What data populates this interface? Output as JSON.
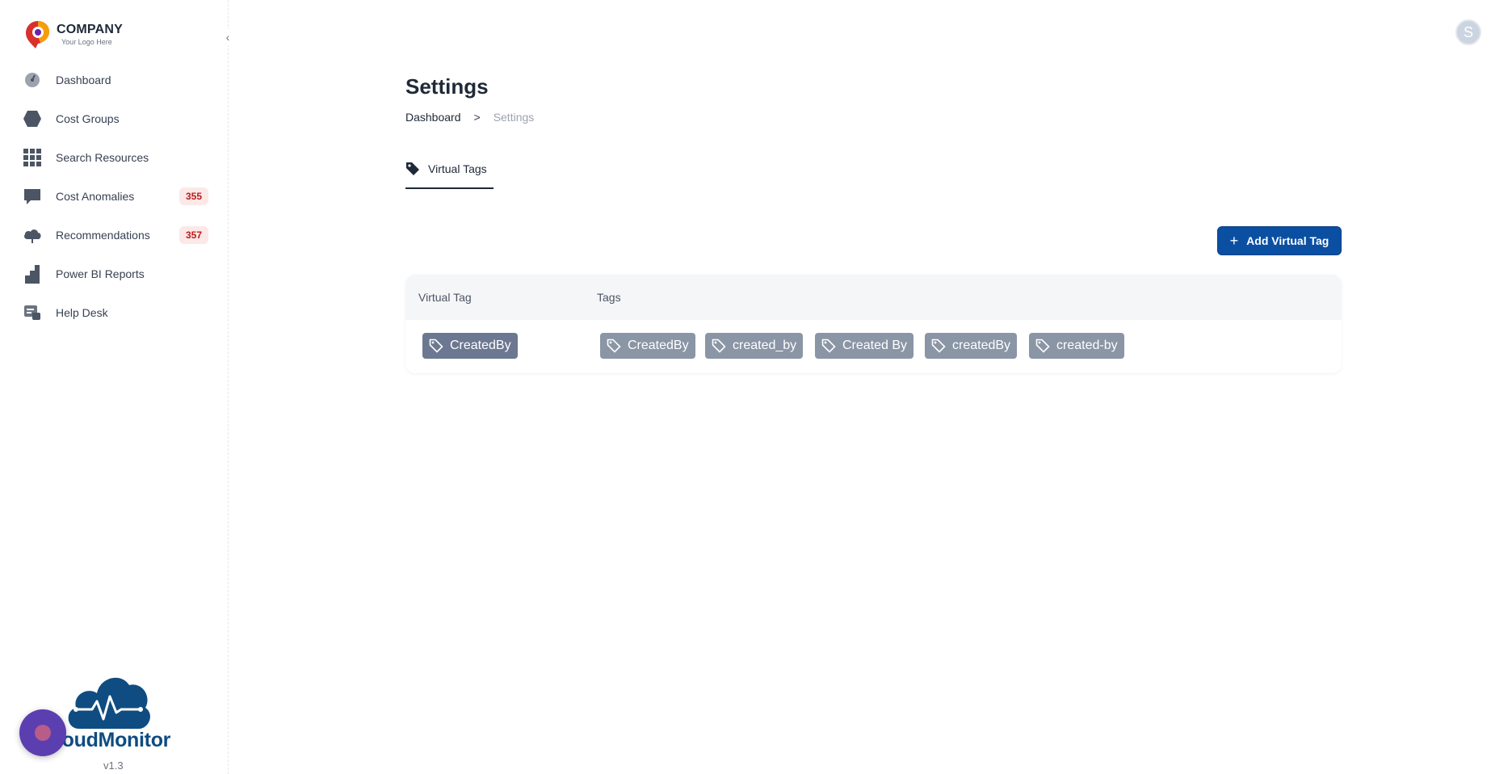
{
  "logo": {
    "name": "COMPANY",
    "tagline": "Your Logo Here"
  },
  "sidebar": {
    "items": [
      {
        "label": "Dashboard",
        "icon": "gauge-icon"
      },
      {
        "label": "Cost Groups",
        "icon": "hexagon-icon"
      },
      {
        "label": "Search Resources",
        "icon": "grid-icon"
      },
      {
        "label": "Cost Anomalies",
        "icon": "chat-icon",
        "badge": "355"
      },
      {
        "label": "Recommendations",
        "icon": "cloud-icon",
        "badge": "357"
      },
      {
        "label": "Power BI Reports",
        "icon": "bar-chart-icon"
      },
      {
        "label": "Help Desk",
        "icon": "help-desk-icon"
      }
    ]
  },
  "brand": {
    "name": "loudMonitor",
    "version": "v1.3"
  },
  "user": {
    "initial": "S"
  },
  "page": {
    "title": "Settings",
    "breadcrumb": {
      "home": "Dashboard",
      "separator": ">",
      "current": "Settings"
    },
    "tabs": [
      {
        "label": "Virtual Tags",
        "icon": "tag-icon",
        "active": true
      }
    ]
  },
  "actions": {
    "add_label": "Add Virtual Tag",
    "add_icon": "+"
  },
  "table": {
    "headers": {
      "virtual_tag": "Virtual Tag",
      "tags": "Tags"
    },
    "rows": [
      {
        "virtual_tag": "CreatedBy",
        "tags": [
          "CreatedBy",
          "created_by",
          "Created By",
          "createdBy",
          "created-by"
        ]
      }
    ]
  },
  "colors": {
    "primary": "#0b4fa3",
    "chip": "#8a95a5",
    "badge_bg": "#fde8e8",
    "badge_text": "#b91c1c",
    "brand": "#0f4c81"
  }
}
